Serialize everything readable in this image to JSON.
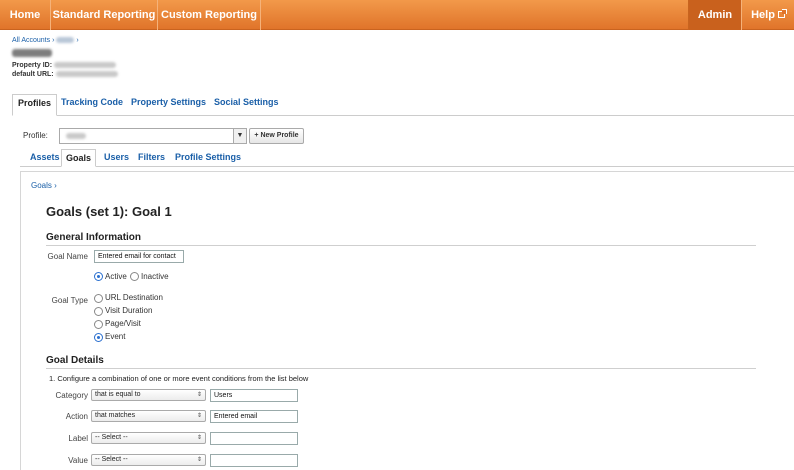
{
  "nav": {
    "home": "Home",
    "standard_reporting": "Standard Reporting",
    "custom_reporting": "Custom Reporting",
    "admin": "Admin",
    "help": "Help"
  },
  "header": {
    "all_accounts": "All Accounts",
    "property_id_label": "Property ID:",
    "default_url_label": "default URL:"
  },
  "main_tabs": [
    "Profiles",
    "Tracking Code",
    "Property Settings",
    "Social Settings"
  ],
  "profile": {
    "label": "Profile:",
    "new_profile": "+ New Profile"
  },
  "sub_tabs": [
    "Assets",
    "Goals",
    "Users",
    "Filters",
    "Profile Settings"
  ],
  "goals": {
    "breadcrumb": "Goals",
    "title": "Goals (set 1): Goal 1",
    "general_info": "General Information",
    "goal_name_label": "Goal Name",
    "goal_name_value": "Entered email for contact",
    "active": "Active",
    "inactive": "Inactive",
    "goal_type_label": "Goal Type",
    "types": [
      "URL Destination",
      "Visit Duration",
      "Page/Visit",
      "Event"
    ],
    "details_title": "Goal Details",
    "instruction": "1. Configure a combination of one or more event conditions from the list below",
    "conditions": [
      {
        "label": "Category",
        "operator": "that is equal to",
        "value": ""
      },
      {
        "label": "Action",
        "operator": "that matches",
        "value": "Entered email"
      },
      {
        "label": "Label",
        "operator": "-- Select --",
        "value": ""
      },
      {
        "label": "Value",
        "operator": "-- Select --",
        "value": ""
      }
    ],
    "category_value": "Users"
  }
}
